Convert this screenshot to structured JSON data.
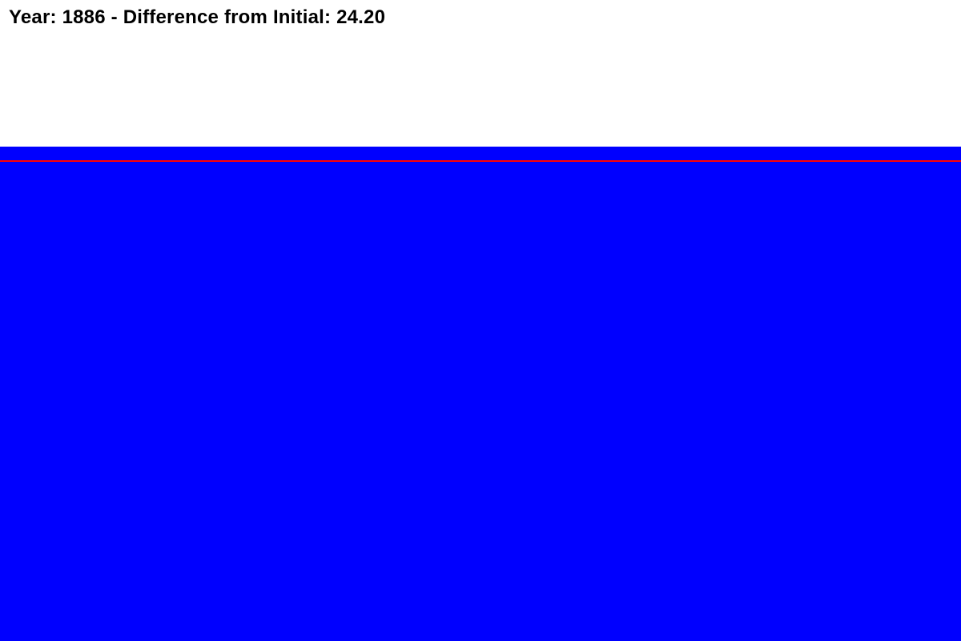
{
  "status": {
    "text": "Year: 1886 - Difference from Initial: 24.20",
    "year": 1886,
    "difference_from_initial": 24.2
  },
  "colors": {
    "background": "#ffffff",
    "water": "#0000ff",
    "initial_level_line": "#ff0000",
    "text": "#000000"
  }
}
